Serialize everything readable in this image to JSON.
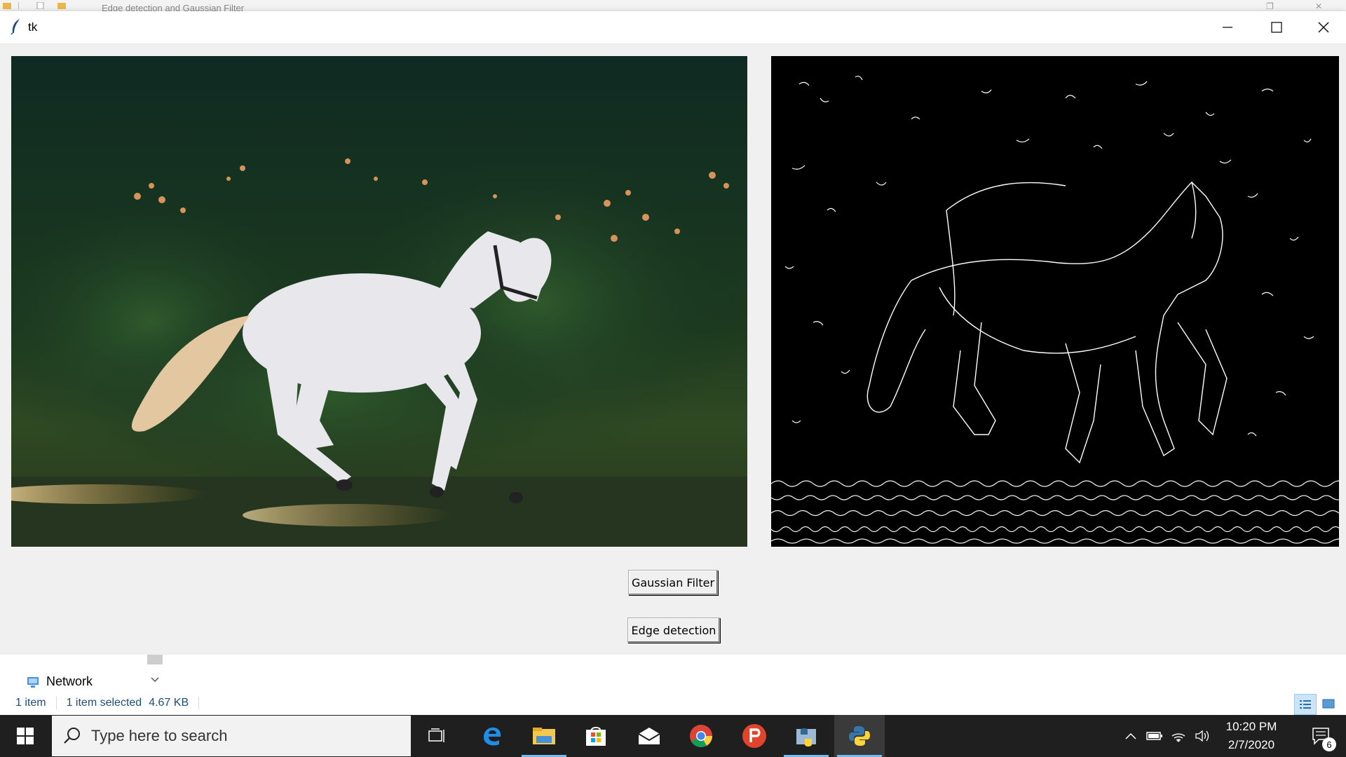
{
  "background_window": {
    "title": "Edge detection and Gaussian Filter"
  },
  "tk_window": {
    "title": "tk",
    "buttons": {
      "gaussian": "Gaussian Filter",
      "edge": "Edge detection"
    },
    "images": {
      "left": "original photo of white horse galloping",
      "right": "edge detection output (white edges on black)"
    }
  },
  "explorer": {
    "nav_item": "Network",
    "status": {
      "items": "1 item",
      "selected": "1 item selected",
      "size": "4.67 KB"
    }
  },
  "taskbar": {
    "search_placeholder": "Type here to search",
    "time": "10:20 PM",
    "date": "2/7/2020",
    "notification_count": "6"
  },
  "colors": {
    "window_bg": "#f0f0f0",
    "taskbar_bg": "#1f1f1f",
    "accent": "#76b9ed"
  }
}
